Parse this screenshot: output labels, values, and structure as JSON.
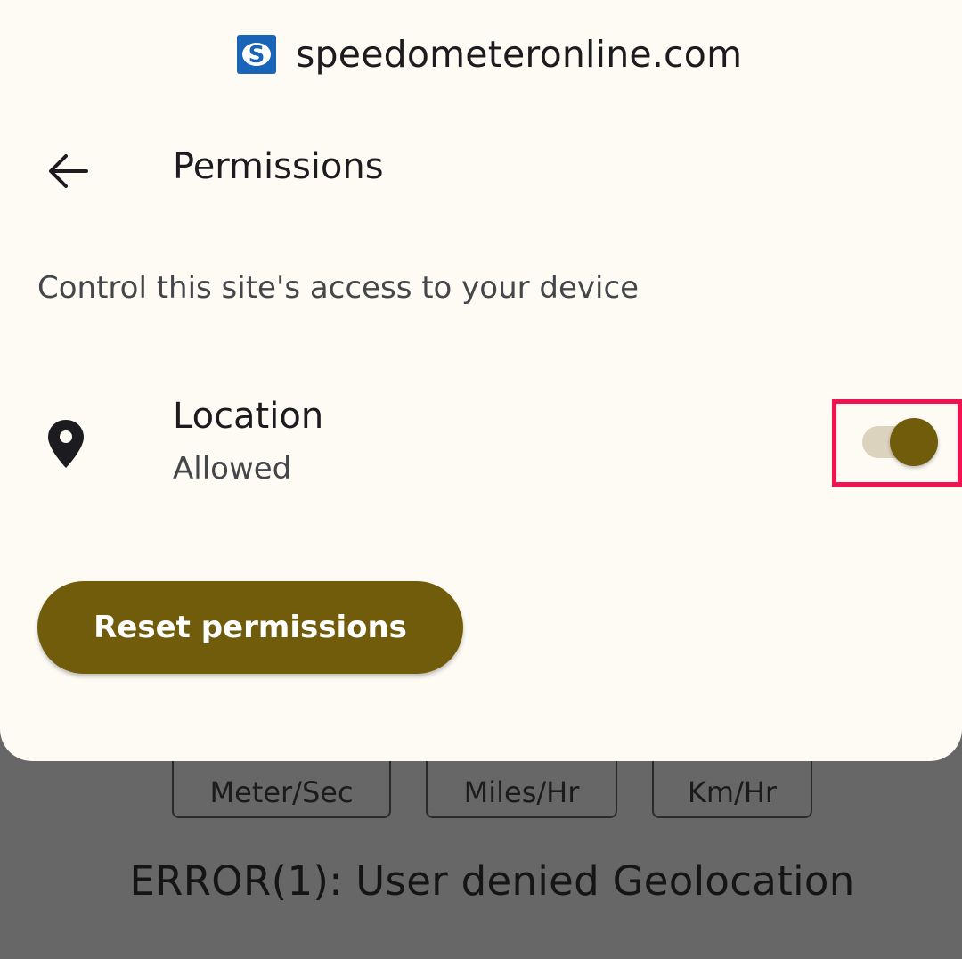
{
  "dialog": {
    "site": {
      "favicon_letter": "S",
      "name": "speedometeronline.com"
    },
    "title": "Permissions",
    "description": "Control this site's access to your device",
    "permission": {
      "icon": "location-pin-icon",
      "title": "Location",
      "status": "Allowed",
      "enabled": true
    },
    "reset_label": "Reset permissions"
  },
  "background": {
    "units": [
      "Meter/Sec",
      "Miles/Hr",
      "Km/Hr"
    ],
    "error": "ERROR(1): User denied Geolocation"
  },
  "colors": {
    "accent": "#715c0c",
    "highlight": "#f0134f",
    "favicon": "#1a64b8",
    "sheet_bg": "#fefbf5",
    "scrim": "#676767"
  }
}
